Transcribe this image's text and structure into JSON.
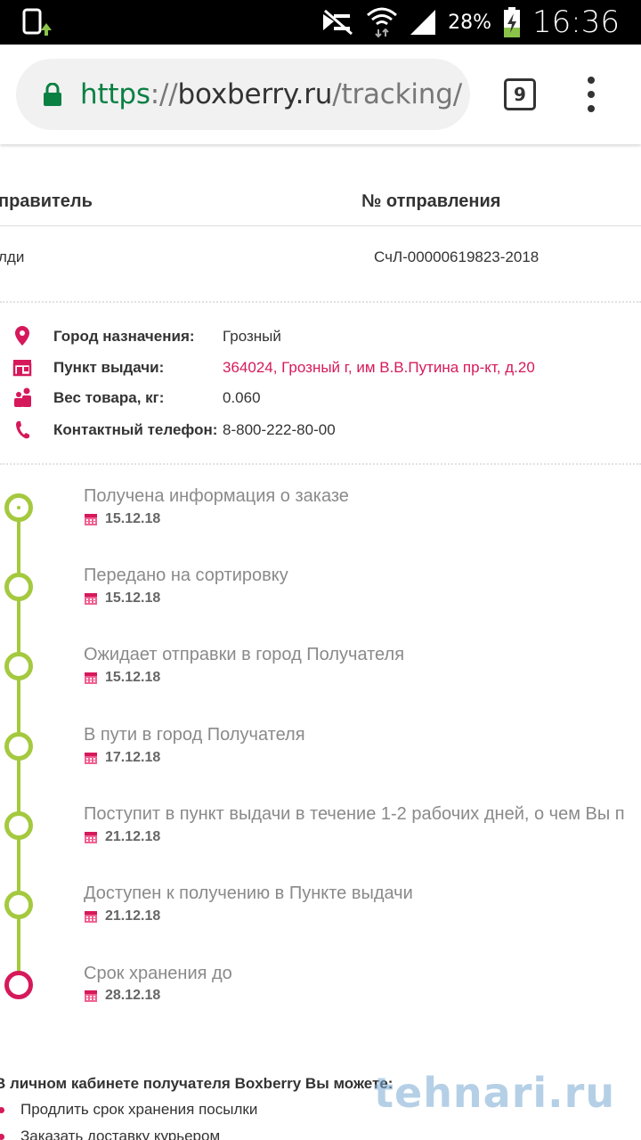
{
  "status_bar": {
    "battery_percent": "28%",
    "time": "16:36",
    "icons": [
      "screen-rotate-icon",
      "mute-icon",
      "wifi-icon",
      "signal-icon",
      "battery-charging-icon"
    ]
  },
  "browser": {
    "url_scheme": "https",
    "url_sep": "://",
    "url_host": "boxberry.ru",
    "url_path": "/tracking/",
    "tab_count": "9"
  },
  "table": {
    "col_sender_header": "правитель",
    "col_number_header": "№ отправления",
    "sender_value": "лди",
    "number_value": "СчЛ-00000619823-2018"
  },
  "info": [
    {
      "label": "Город назначения",
      "colon": ":",
      "value": "Грозный",
      "icon": "location-pin-icon"
    },
    {
      "label": "Пункт выдачи",
      "colon": ":",
      "value": "364024, Грозный г, им В.В.Путина пр-кт, д.20",
      "icon": "store-icon"
    },
    {
      "label": "Вес товара, кг",
      "colon": ":",
      "value": "0.060",
      "icon": "people-icon"
    },
    {
      "label": "Контактный телефон",
      "colon": ":",
      "value": "8-800-222-80-00",
      "icon": "phone-icon"
    }
  ],
  "timeline": [
    {
      "title": "Получена информация о заказе",
      "date": "15.12.18"
    },
    {
      "title": "Передано на сортировку",
      "date": "15.12.18"
    },
    {
      "title": "Ожидает отправки в город Получателя",
      "date": "15.12.18"
    },
    {
      "title": "В пути в город Получателя",
      "date": "17.12.18"
    },
    {
      "title": "Поступит в пункт выдачи в течение 1-2 рабочих дней, о чем Вы п",
      "date": "21.12.18"
    },
    {
      "title": "Доступен к получению в Пункте выдачи",
      "date": "21.12.18"
    },
    {
      "title": "Срок хранения до",
      "date": "28.12.18"
    }
  ],
  "cabinet": {
    "heading": "В личном кабинете получателя Boxberry Вы можете:",
    "items": [
      "Продлить срок хранения посылки",
      "Заказать доставку курьером"
    ]
  },
  "watermark": "tehnari.ru",
  "colors": {
    "accent_pink": "#d6195b",
    "timeline_green": "#a4c93f",
    "https_green": "#0b8043"
  }
}
